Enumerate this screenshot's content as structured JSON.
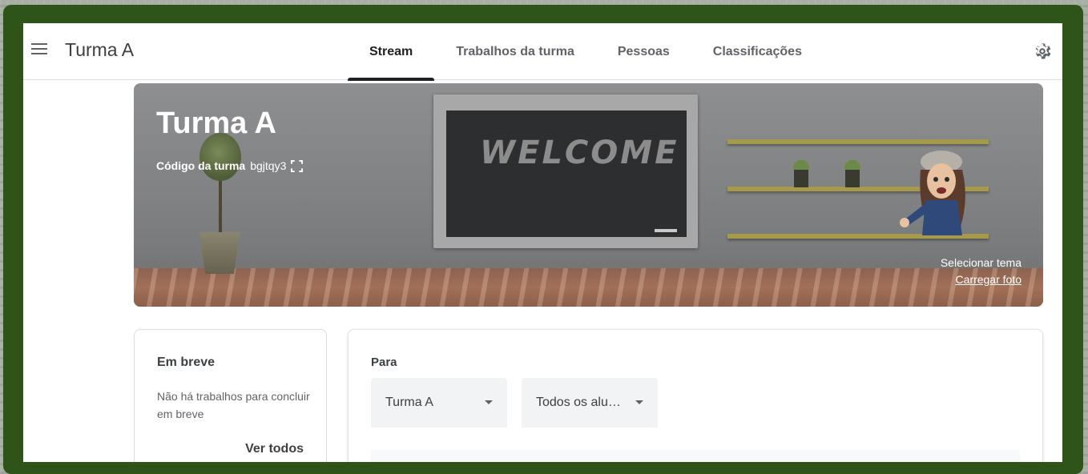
{
  "header": {
    "class_name": "Turma A",
    "tabs": [
      {
        "label": "Stream",
        "active": true
      },
      {
        "label": "Trabalhos da turma",
        "active": false
      },
      {
        "label": "Pessoas",
        "active": false
      },
      {
        "label": "Classificações",
        "active": false
      }
    ],
    "menu_icon": "hamburger-menu-icon",
    "settings_icon": "gear-icon"
  },
  "banner": {
    "title": "Turma A",
    "code_label": "Código da turma",
    "code_value": "bgjtqy3",
    "board_text": "WELCOME",
    "select_theme": "Selecionar tema",
    "upload_photo": "Carregar foto"
  },
  "upcoming": {
    "title": "Em breve",
    "text": "Não há trabalhos para concluir em breve",
    "view_all": "Ver todos"
  },
  "post": {
    "for_label": "Para",
    "class_select": "Turma A",
    "students_select": "Todos os alu…"
  },
  "colors": {
    "frame_green": "#2e5419",
    "text_primary": "#202124",
    "text_secondary": "#5f6368"
  }
}
